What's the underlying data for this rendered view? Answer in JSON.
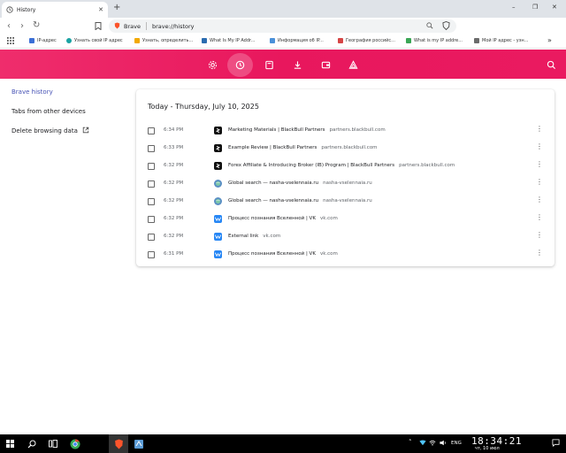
{
  "tab": {
    "title": "History",
    "close": "✕"
  },
  "new_tab": "+",
  "window_controls": {
    "minimize": "–",
    "maximize": "❐",
    "close": "✕"
  },
  "omnibox": {
    "brand": "Brave",
    "url": "brave://history"
  },
  "bookmarks": [
    {
      "label": "IP-адрес",
      "color": "#3b6fd6"
    },
    {
      "label": "Узнать свой IP адрес",
      "color": "#1aa3a3"
    },
    {
      "label": "Узнать, определить...",
      "color": "#f2a900"
    },
    {
      "label": "What Is My IP Addr...",
      "color": "#2b6cb0"
    },
    {
      "label": "Информация об IP...",
      "color": "#4a90d9"
    },
    {
      "label": "География российс...",
      "color": "#d64545"
    },
    {
      "label": "What is my IP addre...",
      "color": "#3aa655"
    },
    {
      "label": "Мой IP адрес - узн...",
      "color": "#6b6b6b"
    }
  ],
  "sidebar": {
    "items": [
      {
        "label": "Brave history"
      },
      {
        "label": "Tabs from other devices"
      },
      {
        "label": "Delete browsing data"
      }
    ]
  },
  "history": {
    "day_title": "Today - Thursday, July 10, 2025",
    "rows": [
      {
        "time": "6:34 PM",
        "title": "Marketing Materials | BlackBull Partners",
        "domain": "partners.blackbull.com",
        "icon": "blackbull-icon"
      },
      {
        "time": "6:33 PM",
        "title": "Example Review | BlackBull Partners",
        "domain": "partners.blackbull.com",
        "icon": "blackbull-icon"
      },
      {
        "time": "6:32 PM",
        "title": "Forex Affiliate & Introducing Broker (IB) Program | BlackBull Partners",
        "domain": "partners.blackbull.com",
        "icon": "blackbull-icon"
      },
      {
        "time": "6:32 PM",
        "title": "Global search — nasha-vselennaia.ru",
        "domain": "nasha-vselennaia.ru",
        "icon": "globe-icon"
      },
      {
        "time": "6:32 PM",
        "title": "Global search — nasha-vselennaia.ru",
        "domain": "nasha-vselennaia.ru",
        "icon": "globe-icon"
      },
      {
        "time": "6:32 PM",
        "title": "Процесс познания Вселенной | VK",
        "domain": "vk.com",
        "icon": "vk-icon"
      },
      {
        "time": "6:32 PM",
        "title": "External link",
        "domain": "vk.com",
        "icon": "vk-icon"
      },
      {
        "time": "6:31 PM",
        "title": "Процесс познания Вселенной | VK",
        "domain": "vk.com",
        "icon": "vk-icon"
      }
    ]
  },
  "taskbar": {
    "tray_lang": "ENG",
    "clock_time": "18:34:21",
    "clock_date": "чт, 10 июл"
  },
  "colors": {
    "brand_gradient": "#e8175d",
    "accent": "#4753b5"
  }
}
